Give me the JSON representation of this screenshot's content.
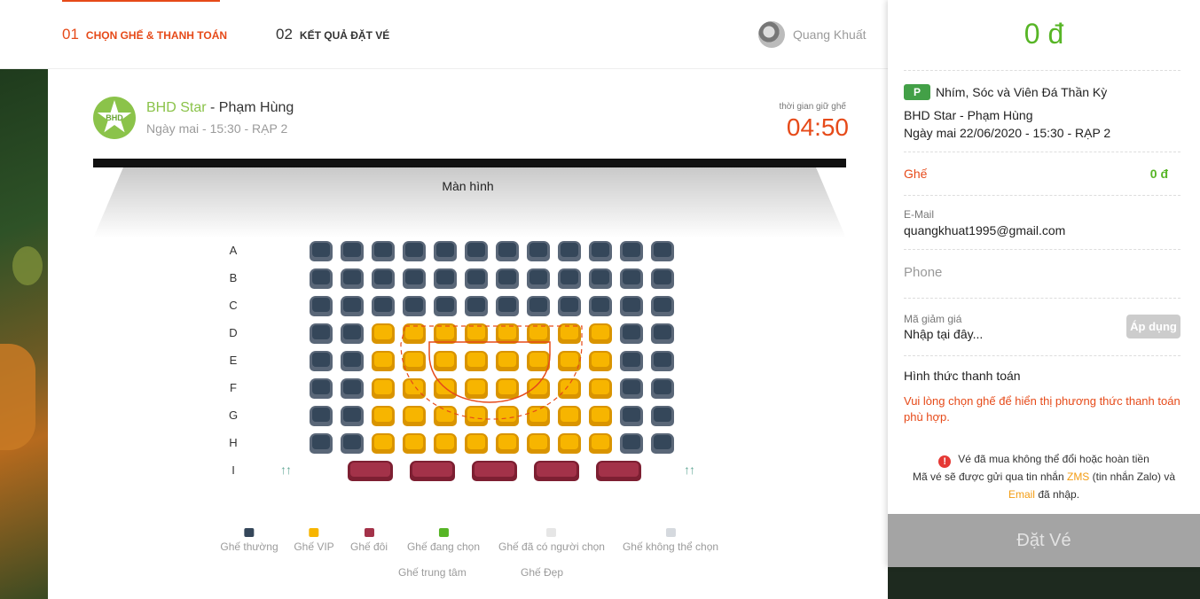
{
  "steps": [
    {
      "num": "01",
      "label": "CHỌN GHẾ & THANH TOÁN"
    },
    {
      "num": "02",
      "label": "KẾT QUẢ ĐẶT VÉ"
    }
  ],
  "user": {
    "name": "Quang Khuất"
  },
  "cinema": {
    "logo_text": "BHD",
    "brand": "BHD Star",
    "separator": " - ",
    "branch": "Phạm Hùng",
    "showtime": "Ngày mai - 15:30 - RẠP 2"
  },
  "hold": {
    "label": "thời gian giữ ghế",
    "time": "04:50"
  },
  "screen_label": "Màn hình",
  "rows": [
    "A",
    "B",
    "C",
    "D",
    "E",
    "F",
    "G",
    "H",
    "I"
  ],
  "exit_icon": "↑↑",
  "legend": [
    {
      "label": "Ghế thường",
      "color": "#35475a"
    },
    {
      "label": "Ghế VIP",
      "color": "#f7b500"
    },
    {
      "label": "Ghế đôi",
      "color": "#a33249"
    },
    {
      "label": "Ghế đang chọn",
      "color": "#57b526"
    },
    {
      "label": "Ghế đã có người chọn",
      "color": "#e6e6e6"
    },
    {
      "label": "Ghế không thể chọn",
      "color": "#d5d9de"
    }
  ],
  "legend_lines": [
    {
      "label": "Ghế trung tâm",
      "style": "dashed",
      "color": "#e64a19"
    },
    {
      "label": "Ghế Đẹp",
      "style": "solid",
      "color": "#e64a19"
    }
  ],
  "sidebar": {
    "total": "0 đ",
    "rating": "P",
    "movie_title": "Nhím, Sóc và Viên Đá Thần Kỳ",
    "cinema": "BHD Star - Phạm Hùng",
    "datetime": "Ngày mai 22/06/2020 - 15:30 - RẠP 2",
    "seat_label": "Ghế",
    "seat_price": "0 đ",
    "email_label": "E-Mail",
    "email": "quangkhuat1995@gmail.com",
    "phone_placeholder": "Phone",
    "discount_label": "Mã giảm giá",
    "discount_placeholder": "Nhập tại đây...",
    "apply": "Áp dụng",
    "payment_title": "Hình thức thanh toán",
    "payment_note": "Vui lòng chọn ghế để hiển thị phương thức thanh toán phù hợp.",
    "notice_line1": "Vé đã mua không thể đổi hoặc hoàn tiền",
    "notice_line2_a": "Mã vé sẽ được gửi qua tin nhắn ",
    "notice_zms": "ZMS",
    "notice_line2_b": " (tin nhắn Zalo) và",
    "notice_email": "Email",
    "notice_line3": " đã nhập.",
    "book_button": "Đặt Vé"
  },
  "colors": {
    "accent": "#e64a19",
    "green": "#57b526",
    "normal_seat": "#35475a",
    "vip_seat": "#f7b500",
    "couple_seat": "#a33249"
  }
}
